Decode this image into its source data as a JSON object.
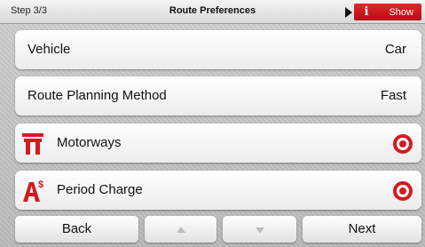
{
  "header": {
    "step": "Step 3/3",
    "title": "Route Preferences",
    "show_label": "Show"
  },
  "rows": [
    {
      "label": "Vehicle",
      "value": "Car"
    },
    {
      "label": "Route Planning Method",
      "value": "Fast"
    },
    {
      "label": "Motorways",
      "icon": "motorway-icon",
      "selected": true
    },
    {
      "label": "Period Charge",
      "icon": "period-charge-icon",
      "selected": true
    }
  ],
  "buttons": {
    "back": "Back",
    "up": "",
    "down": "",
    "next": "Next"
  },
  "colors": {
    "accent_red": "#d31a22"
  }
}
